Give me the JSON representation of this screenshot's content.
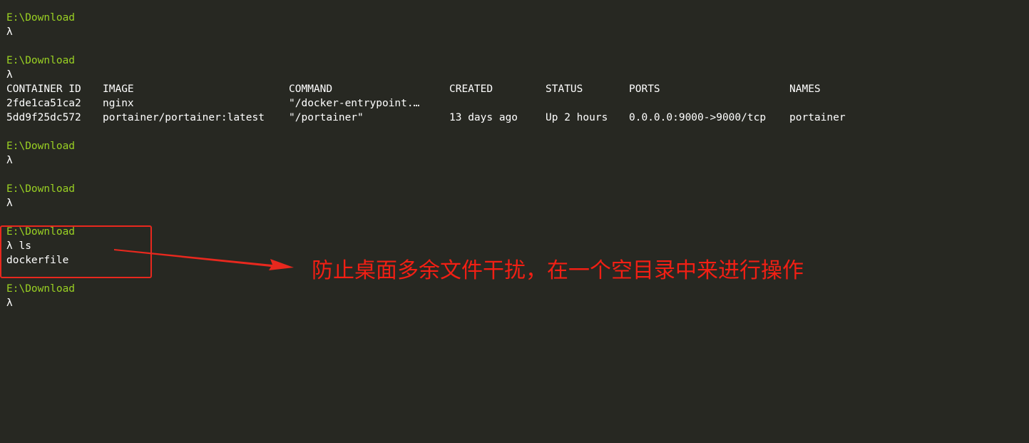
{
  "prompt_symbol": "λ",
  "blocks": [
    {
      "path": "E:\\Download",
      "command": ""
    },
    {
      "path": "E:\\Download",
      "command": ""
    },
    {
      "path": "E:\\Download",
      "command": ""
    },
    {
      "path": "E:\\Download",
      "command": ""
    },
    {
      "path": "E:\\Download",
      "command": "ls"
    },
    {
      "path": "E:\\Download",
      "command": ""
    }
  ],
  "docker_ps": {
    "headers": [
      "CONTAINER ID",
      "IMAGE",
      "COMMAND",
      "CREATED",
      "STATUS",
      "PORTS",
      "NAMES"
    ],
    "rows": [
      [
        "2fde1ca51ca2",
        "nginx",
        "\"/docker-entrypoint.…",
        "",
        "",
        "",
        ""
      ],
      [
        "5dd9f25dc572",
        "portainer/portainer:latest",
        "\"/portainer\"",
        "13 days ago",
        "Up 2 hours",
        "0.0.0.0:9000->9000/tcp",
        "portainer"
      ]
    ]
  },
  "ls_output": "dockerfile",
  "annotation": {
    "text": "防止桌面多余文件干扰，在一个空目录中来进行操作",
    "color": "#f21f14"
  },
  "colors": {
    "background": "#272822",
    "path": "#9ad123",
    "text": "#ffffff",
    "highlight": "#e8281e"
  }
}
